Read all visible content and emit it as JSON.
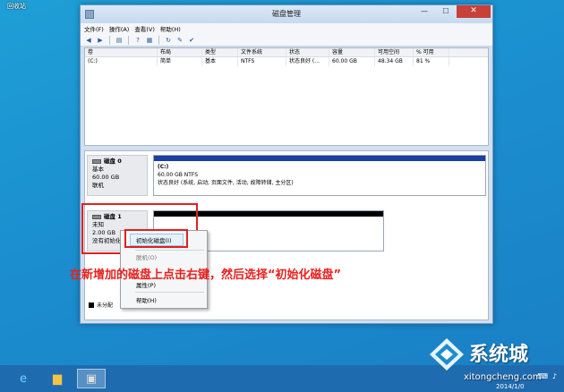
{
  "desktop": {
    "label": "回收站"
  },
  "window": {
    "title": "磁盘管理",
    "controls": {
      "minimize": "—",
      "maximize": "☐",
      "close": "✕"
    }
  },
  "menubar": [
    "文件(F)",
    "操作(A)",
    "查看(V)",
    "帮助(H)"
  ],
  "toolbar_icons": [
    "back-arrow-icon",
    "forward-arrow-icon",
    "list-icon",
    "help-icon",
    "properties-icon",
    "refresh-icon",
    "settings-icon",
    "check-icon"
  ],
  "volume_table": {
    "headers": [
      "卷",
      "布局",
      "类型",
      "文件系统",
      "状态",
      "容量",
      "可用空间",
      "% 可用"
    ],
    "rows": [
      [
        "(C:)",
        "简单",
        "基本",
        "NTFS",
        "状态良好 (...",
        "60.00 GB",
        "48.34 GB",
        "81 %"
      ]
    ]
  },
  "disks": [
    {
      "name": "磁盘 0",
      "type": "基本",
      "size": "60.00 GB",
      "status": "联机",
      "partition": {
        "label": "(C:)",
        "detail": "60.00 GB NTFS",
        "state": "状态良好 (系统, 启动, 页面文件, 活动, 故障转储, 主分区)"
      }
    },
    {
      "name": "磁盘 1",
      "type": "未知",
      "size": "2.00 GB",
      "status": "没有初始化"
    }
  ],
  "legend": {
    "unallocated": "未分配"
  },
  "context_menu": {
    "items": [
      "初始化磁盘(I)",
      "脱机(O)",
      "属性(P)",
      "帮助(H)"
    ]
  },
  "instruction": "在新增加的磁盘上点击右键，然后选择“初始化磁盘”",
  "watermark": {
    "brand": "系统城",
    "url": "xitongcheng.com",
    "date": "2014/1/0"
  },
  "colors": {
    "primary_partition": "#1a3fa0",
    "unallocated": "#000000",
    "highlight": "#e02020"
  }
}
